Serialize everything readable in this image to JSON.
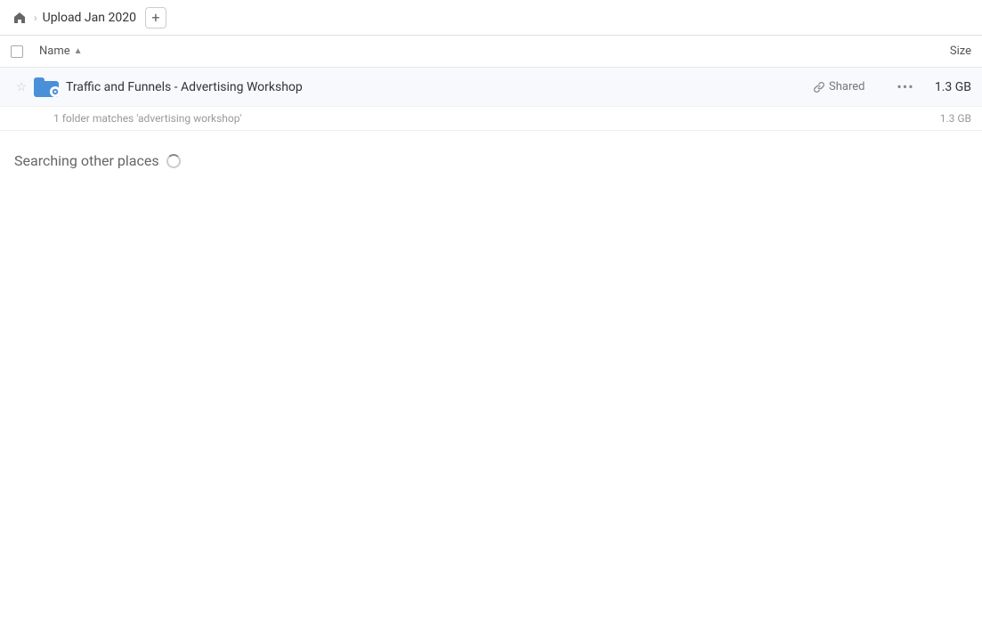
{
  "header": {
    "home_icon": "🏠",
    "separator": "›",
    "breadcrumb_label": "Upload Jan 2020",
    "add_tab_icon": "+"
  },
  "table": {
    "checkbox_col": "",
    "name_col_label": "Name",
    "sort_arrow": "▲",
    "size_col_label": "Size"
  },
  "result_row": {
    "name": "Traffic and Funnels - Advertising Workshop",
    "shared_label": "Shared",
    "more_icon": "···",
    "size": "1.3 GB",
    "star_icon": "☆",
    "link_icon": "🔗"
  },
  "match_info": {
    "text": "1 folder matches 'advertising workshop'",
    "size": "1.3 GB"
  },
  "searching_section": {
    "label": "Searching other places"
  }
}
